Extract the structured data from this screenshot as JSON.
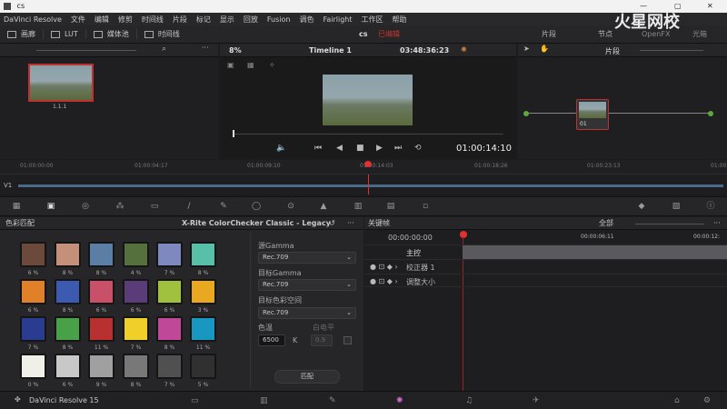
{
  "window": {
    "title": "cs",
    "watermark": "火星网校",
    "watermark_url": "www.hxsd.tv"
  },
  "menu": [
    "DaVinci Resolve",
    "文件",
    "编辑",
    "修剪",
    "时间线",
    "片段",
    "标记",
    "显示",
    "回放",
    "Fusion",
    "调色",
    "Fairlight",
    "工作区",
    "帮助"
  ],
  "toolbar": {
    "gallery": "画廊",
    "lut": "LUT",
    "media": "媒体池",
    "timeline": "时间线",
    "project": "cs",
    "status": "已编辑",
    "clips": "片段",
    "nodes": "节点",
    "openfx": "OpenFX",
    "lightbox": "光箱"
  },
  "viewer": {
    "zoom": "8%",
    "timeline_name": "Timeline 1",
    "timecode": "03:48:36:23",
    "playhead_tc": "01:00:14:10",
    "clip_label": "片段"
  },
  "clip": {
    "index": "1.1.1",
    "node_label": "01"
  },
  "ruler": [
    "01:00:00:00",
    "01:00:04:17",
    "01:00:09:10",
    "01:00:14:03",
    "01:00:18:26",
    "01:00:23:13",
    "01:00:28"
  ],
  "track": {
    "label": "V1"
  },
  "colormatch": {
    "title": "色彩匹配",
    "chart": "X-Rite ColorChecker Classic - Legacy",
    "swatches": [
      {
        "color": "#6b4a3c",
        "pct": "6 %"
      },
      {
        "color": "#c4907a",
        "pct": "8 %"
      },
      {
        "color": "#5a7ea6",
        "pct": "8 %"
      },
      {
        "color": "#55703c",
        "pct": "4 %"
      },
      {
        "color": "#8088c0",
        "pct": "7 %"
      },
      {
        "color": "#58c0a8",
        "pct": "8 %"
      },
      {
        "color": "#e08028",
        "pct": "6 %"
      },
      {
        "color": "#3c5ab0",
        "pct": "8 %"
      },
      {
        "color": "#c85068",
        "pct": "6 %"
      },
      {
        "color": "#5a3c78",
        "pct": "6 %"
      },
      {
        "color": "#a0c040",
        "pct": "6 %"
      },
      {
        "color": "#e8a820",
        "pct": "3 %"
      },
      {
        "color": "#2a3c90",
        "pct": "7 %"
      },
      {
        "color": "#48a048",
        "pct": "8 %"
      },
      {
        "color": "#b83030",
        "pct": "11 %"
      },
      {
        "color": "#f0d028",
        "pct": "7 %"
      },
      {
        "color": "#c04898",
        "pct": "8 %"
      },
      {
        "color": "#1898c0",
        "pct": "11 %"
      },
      {
        "color": "#f0f0e8",
        "pct": "0 %"
      },
      {
        "color": "#c8c8c8",
        "pct": "6 %"
      },
      {
        "color": "#a0a0a0",
        "pct": "9 %"
      },
      {
        "color": "#787878",
        "pct": "8 %"
      },
      {
        "color": "#505050",
        "pct": "7 %"
      },
      {
        "color": "#303030",
        "pct": "5 %"
      }
    ],
    "source_gamma_label": "源Gamma",
    "source_gamma": "Rec.709",
    "target_gamma_label": "目标Gamma",
    "target_gamma": "Rec.709",
    "target_space_label": "目标色彩空间",
    "target_space": "Rec.709",
    "temp_label": "色温",
    "temp": "6500",
    "temp_unit": "K",
    "white_label": "白电平",
    "white": "0.9",
    "match_button": "匹配"
  },
  "keyframes": {
    "title": "关键帧",
    "filter": "全部",
    "tc_start": "00:00:00:00",
    "tc_mid": "00:00:06:11",
    "tc_end": "00:00:12:",
    "rows": [
      {
        "label": "主控"
      },
      {
        "label": "校正器 1"
      },
      {
        "label": "调整大小"
      }
    ]
  },
  "bottom": {
    "app": "DaVinci Resolve 15"
  }
}
